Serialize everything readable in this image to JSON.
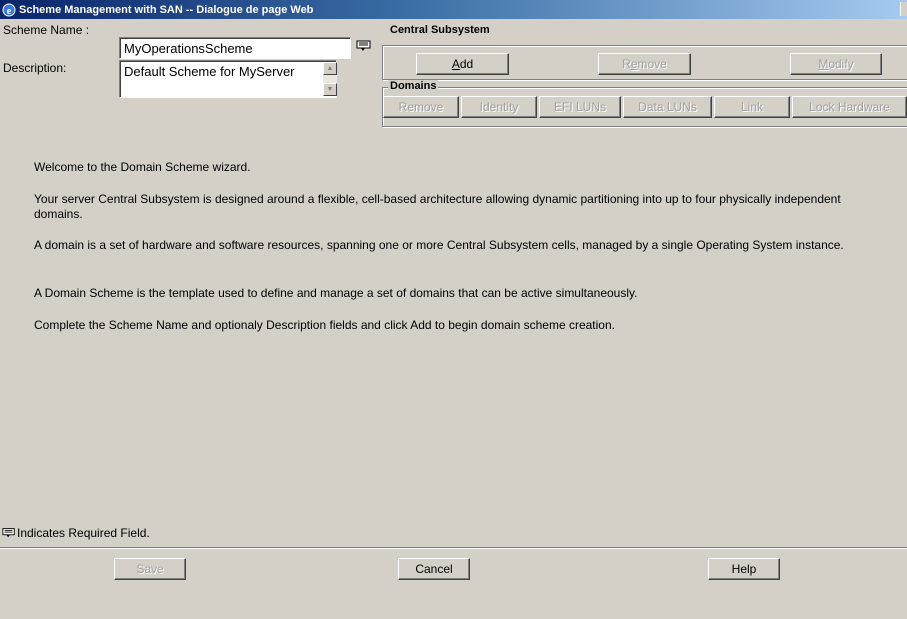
{
  "window": {
    "title": "Scheme Management with SAN -- Dialogue de page Web"
  },
  "form": {
    "scheme_name_label": "Scheme Name :",
    "scheme_name_value": "MyOperationsScheme",
    "description_label": "Description:",
    "description_value": "Default Scheme for MyServer"
  },
  "central_subsystem": {
    "title": "Central Subsystem",
    "buttons": [
      {
        "label": "Add",
        "mnemonic": "A",
        "rest": "dd",
        "enabled": true
      },
      {
        "label": "Remove",
        "mnemonic": "e",
        "pre": "R",
        "rest": "move",
        "enabled": false
      },
      {
        "label": "Modify",
        "mnemonic": "M",
        "rest": "odify",
        "enabled": false
      }
    ]
  },
  "domains": {
    "title": "Domains",
    "buttons": [
      {
        "label": "Remove",
        "enabled": false
      },
      {
        "label": "Identity",
        "enabled": false
      },
      {
        "label": "EFI LUNs",
        "enabled": false
      },
      {
        "label": "Data LUNs",
        "enabled": false
      },
      {
        "label": "Link",
        "enabled": false
      },
      {
        "label": "Lock Hardware",
        "enabled": false
      }
    ]
  },
  "content": {
    "paragraphs": [
      "Welcome to the Domain Scheme wizard.",
      "Your server Central Subsystem is designed around a flexible, cell-based architecture allowing dynamic partitioning into up to four physically independent domains.",
      "A domain is a set of hardware and software resources, spanning one or more Central Subsystem cells, managed by a single Operating System instance.",
      "A Domain Scheme is the template used to define and manage a set of domains that can be active simultaneously.",
      "Complete the Scheme Name and optionaly Description fields and click Add to begin domain scheme creation."
    ]
  },
  "footer": {
    "required_note": "Indicates Required Field.",
    "save_label": "Save",
    "cancel_label": "Cancel",
    "help_label": "Help"
  }
}
